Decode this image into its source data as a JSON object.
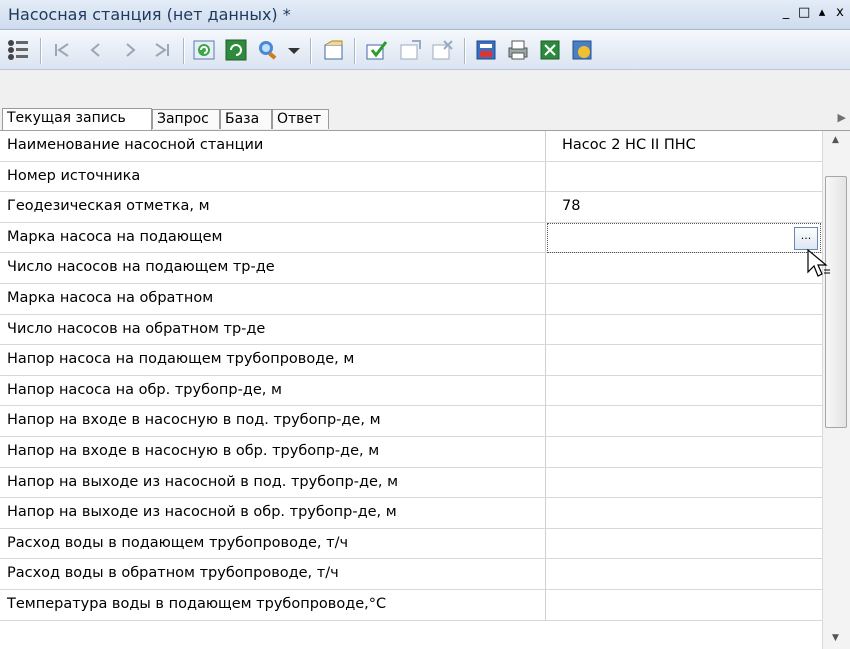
{
  "window": {
    "title": "Насосная станция (нет данных) *"
  },
  "window_buttons": [
    "_",
    "□",
    "▴",
    "x"
  ],
  "toolbar": {
    "icons": [
      "grid-view-icon",
      "first-record-icon",
      "prev-record-icon",
      "next-record-icon",
      "last-record-icon",
      "refresh-icon",
      "sync-icon",
      "query-icon",
      "dropdown-icon",
      "new-record-icon",
      "apply-icon",
      "insert-icon",
      "delete-icon",
      "save-db-icon",
      "print-icon",
      "export-icon",
      "settings-icon"
    ]
  },
  "tabs": [
    {
      "label": "Текущая запись",
      "active": true
    },
    {
      "label": "Запрос",
      "active": false
    },
    {
      "label": "База",
      "active": false
    },
    {
      "label": "Ответ",
      "active": false
    }
  ],
  "properties": [
    {
      "name": "Наименование насосной станции",
      "value": "Насос 2 НС II ПНС"
    },
    {
      "name": "Номер источника",
      "value": ""
    },
    {
      "name": "Геодезическая отметка, м",
      "value": "78"
    },
    {
      "name": "Марка насоса на подающем",
      "value": ""
    },
    {
      "name": "Число насосов на подающем тр-де",
      "value": ""
    },
    {
      "name": "Марка насоса на обратном",
      "value": ""
    },
    {
      "name": "Число насосов на обратном тр-де",
      "value": ""
    },
    {
      "name": "Напор насоса на подающем трубопроводе, м",
      "value": ""
    },
    {
      "name": "Напор насоса на обр. трубопр-де, м",
      "value": ""
    },
    {
      "name": "Напор на входе в насосную в под. трубопр-де, м",
      "value": ""
    },
    {
      "name": "Напор на входе в насосную в обр. трубопр-де, м",
      "value": ""
    },
    {
      "name": "Напор на выходе из насосной в под. трубопр-де, м",
      "value": ""
    },
    {
      "name": "Напор на выходе из насосной в обр. трубопр-де, м",
      "value": ""
    },
    {
      "name": "Расход воды в подающем трубопроводе, т/ч",
      "value": ""
    },
    {
      "name": "Расход воды в обратном трубопроводе, т/ч",
      "value": ""
    },
    {
      "name": "Температура воды в подающем трубопроводе,°С",
      "value": ""
    }
  ],
  "edit": {
    "ellipsis": "..."
  }
}
